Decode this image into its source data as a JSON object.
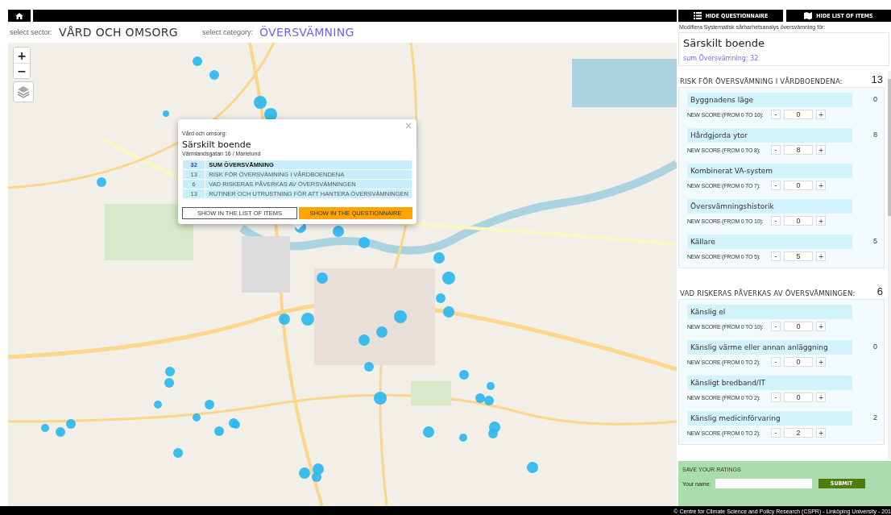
{
  "header": {
    "sector_label": "select sector:",
    "sector": "VÅRD OCH OMSORG",
    "category_label": "select category:",
    "category": "ÖVERSVÄMNING"
  },
  "map": {
    "zoom_in": "+",
    "zoom_out": "−",
    "popup": {
      "close": "×",
      "sector": "Vård och omsorg:",
      "title": "Särskilt boende",
      "address": "Värmlandsgatan 16 / Marielund",
      "rows": [
        {
          "kind": "sum",
          "score": "32",
          "label": "SUM ÖVERSVÄMNING"
        },
        {
          "kind": "part",
          "score": "13",
          "label": "RISK FÖR ÖVERSVÄMNING I VÅRDBOENDENA"
        },
        {
          "kind": "part",
          "score": "6",
          "label": "VAD RISKERAS PÅVERKAS AV ÖVERSVÄMNINGEN"
        },
        {
          "kind": "part",
          "score": "13",
          "label": "RUTINER OCH UTRUSTNING FÖR ATT HANTERA ÖVERSVÄMNINGEN"
        }
      ],
      "buttons": [
        {
          "kind": "secondary",
          "label": "SHOW IN THE LIST OF ITEMS"
        },
        {
          "kind": "primary",
          "label": "SHOW IN THE QUESTIONNAIRE"
        }
      ]
    }
  },
  "panel": {
    "buttons": [
      {
        "kind": "list",
        "label": "HIDE QUESTIONNAIRE"
      },
      {
        "kind": "map",
        "label": "HIDE LIST OF ITEMS"
      }
    ],
    "caption": "Modifiera Systematisk sårbarhetsanalys översvämning för:",
    "title": "Särskilt boende",
    "sum": "sum Översvämning: 32",
    "groups": [
      {
        "title": "RISK FÖR ÖVERSVÄMNING I VÅRDBOENDENA:",
        "total": "13",
        "items": [
          {
            "name": "Byggnadens läge",
            "score": "0",
            "prompt": "NEW SCORE (FROM 0 TO 10):",
            "minus": "-",
            "value": "0",
            "plus": "+"
          },
          {
            "name": "Hårdgjorda ytor",
            "score": "8",
            "prompt": "NEW SCORE (FROM 0 TO 8):",
            "minus": "-",
            "value": "8",
            "plus": "+"
          },
          {
            "name": "Kombinerat VA-system",
            "prompt": "NEW SCORE (FROM 0 TO 7):",
            "minus": "-",
            "value": "0",
            "plus": "+"
          },
          {
            "name": "Översvämningshistorik",
            "prompt": "NEW SCORE (FROM 0 TO 10):",
            "minus": "-",
            "value": "0",
            "plus": "+"
          },
          {
            "name": "Källare",
            "score": "5",
            "prompt": "NEW SCORE (FROM 0 TO 5):",
            "minus": "-",
            "value": "5",
            "plus": "+"
          }
        ]
      },
      {
        "title": "VAD RISKERAS PÅVERKAS AV ÖVERSVÄMNINGEN:",
        "total": "6",
        "items": [
          {
            "name": "Känslig el",
            "prompt": "NEW SCORE (FROM 0 TO 10):",
            "minus": "-",
            "value": "0",
            "plus": "+"
          },
          {
            "name": "Känslig värme eller annan anläggning",
            "score": "0",
            "prompt": "NEW SCORE (FROM 0 TO 2):",
            "minus": "-",
            "value": "0",
            "plus": "+"
          },
          {
            "name": "Känsligt bredband/IT",
            "prompt": "NEW SCORE (FROM 0 TO 2):",
            "minus": "-",
            "value": "0",
            "plus": "+"
          },
          {
            "name": "Känslig medicinförvaring",
            "score": "2",
            "prompt": "NEW SCORE (FROM 0 TO 2):",
            "minus": "-",
            "value": "2",
            "plus": "+"
          }
        ]
      }
    ],
    "save": {
      "title": "SAVE YOUR RATINGS",
      "name_label": "Your name:",
      "button": "SUBMIT"
    }
  },
  "footer": "© Centre for Climate Science and Policy Research (CSPR) - Linköping University - 201"
}
